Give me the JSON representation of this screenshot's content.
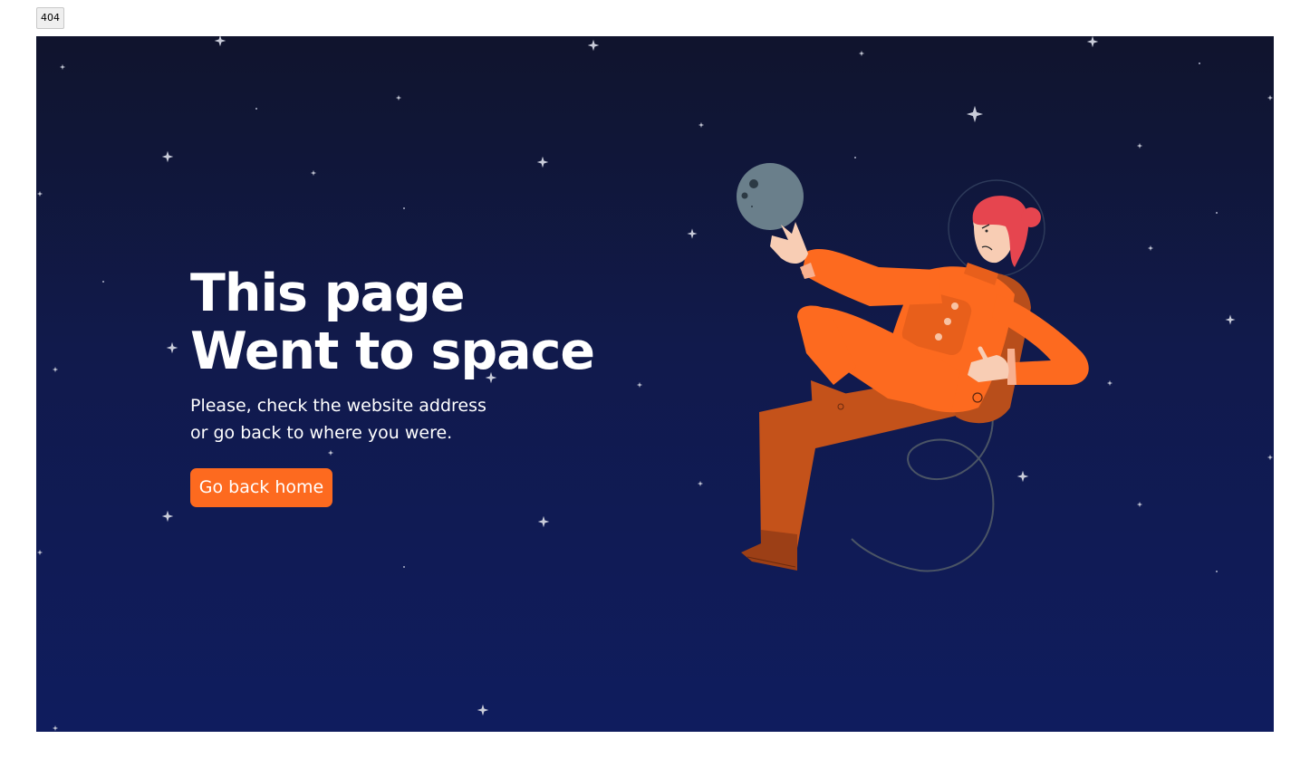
{
  "tab": {
    "label": "404"
  },
  "hero": {
    "title_line1": "This page",
    "title_line2": "Went to space",
    "message_line1": "Please, check the website address",
    "message_line2": "or go back to where you were.",
    "button_label": "Go back home"
  },
  "colors": {
    "accent": "#fd6a1f",
    "background_top": "#10142d",
    "background_bottom": "#0f1c5e",
    "text": "#ffffff"
  },
  "illustration": {
    "subject": "astronaut-floating",
    "props": [
      "moon",
      "tether-cable",
      "stars"
    ]
  }
}
